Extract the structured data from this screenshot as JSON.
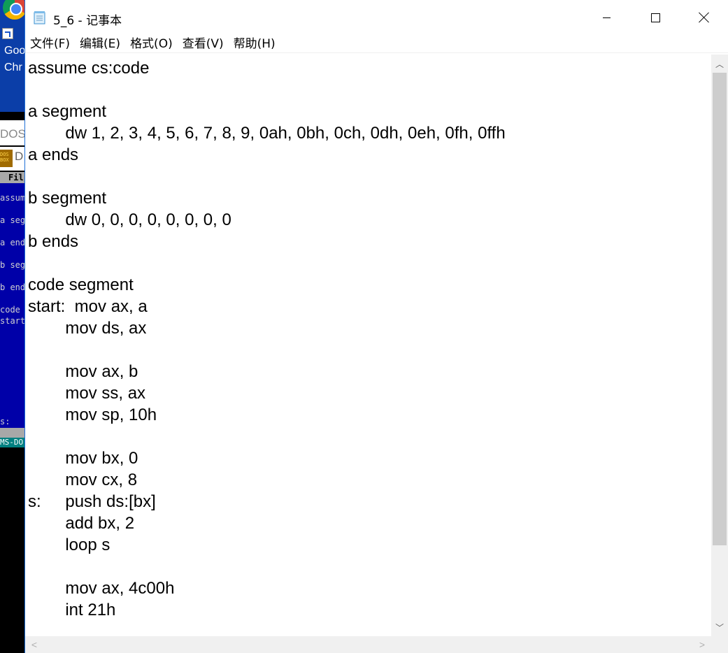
{
  "desktop": {
    "shortcut_label_line1": "Goo",
    "shortcut_label_line2": "Chr"
  },
  "dosbox": {
    "title": "DOS",
    "caption": "D",
    "logo_text": "DOS BOX",
    "menubar": "Fil",
    "lines": [
      "assum",
      "a seg",
      "a end",
      "b seg",
      "b end",
      "code",
      "start",
      "s:"
    ],
    "status_text": "MS-DO"
  },
  "notepad": {
    "title": "5_6 - 记事本",
    "window_controls": {
      "minimize_icon": "minimize-icon",
      "maximize_icon": "maximize-icon",
      "close_icon": "close-icon"
    },
    "menu": [
      "文件(F)",
      "编辑(E)",
      "格式(O)",
      "查看(V)",
      "帮助(H)"
    ],
    "content": "assume cs:code\n\na segment\n\tdw 1, 2, 3, 4, 5, 6, 7, 8, 9, 0ah, 0bh, 0ch, 0dh, 0eh, 0fh, 0ffh\na ends\n\nb segment\n\tdw 0, 0, 0, 0, 0, 0, 0, 0\nb ends\n\ncode segment\nstart:  mov ax, a\n\tmov ds, ax\n\n\tmov ax, b\n\tmov ss, ax\n\tmov sp, 10h\n\n\tmov bx, 0\n\tmov cx, 8\ns:\tpush ds:[bx]\n\tadd bx, 2\n\tloop s\n\n\tmov ax, 4c00h\n\tint 21h"
  }
}
